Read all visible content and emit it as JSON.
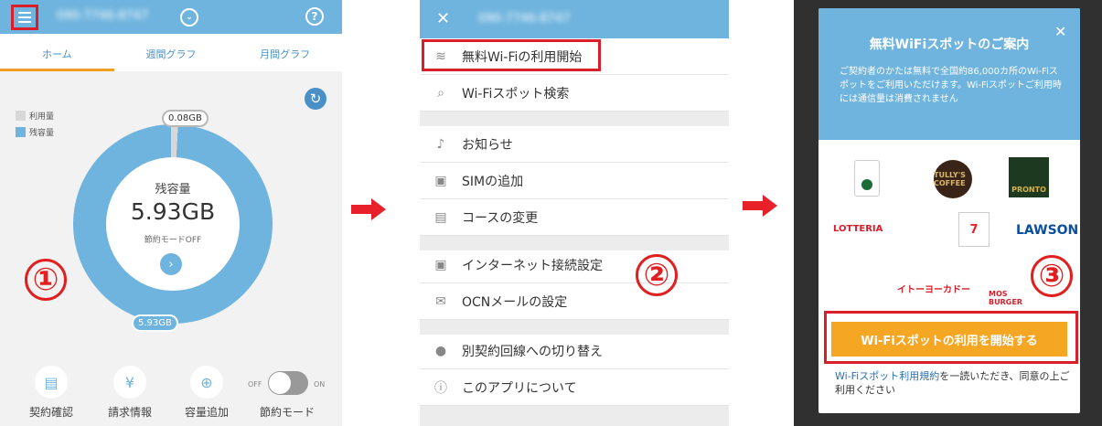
{
  "screen1": {
    "tabs": [
      "ホーム",
      "週間グラフ",
      "月間グラフ"
    ],
    "legend": {
      "used": "利用量",
      "remaining": "残容量"
    },
    "used_pill": "0.08GB",
    "center_label": "残容量",
    "center_value": "5.93GB",
    "saving_mode": "節約モードOFF",
    "bottom_pill": "5.93GB",
    "bottom_items": [
      "契約確認",
      "請求情報",
      "容量追加",
      "節約モード"
    ],
    "toggle_off": "OFF",
    "toggle_on": "ON",
    "step": "①",
    "usage": {
      "used_gb": 0.08,
      "remaining_gb": 5.93
    },
    "colors": {
      "header": "#6fb4de",
      "accent": "#f0a020",
      "highlight": "#d9202a"
    }
  },
  "screen2": {
    "menu": [
      {
        "icon": "wifi-icon",
        "label": "無料Wi-Fiの利用開始"
      },
      {
        "icon": "search-icon",
        "label": "Wi-Fiスポット検索"
      },
      {
        "icon": "bell-icon",
        "label": "お知らせ"
      },
      {
        "icon": "sim-add-icon",
        "label": "SIMの追加"
      },
      {
        "icon": "clipboard-icon",
        "label": "コースの変更"
      },
      {
        "icon": "network-settings-icon",
        "label": "インターネット接続設定"
      },
      {
        "icon": "mail-icon",
        "label": "OCNメールの設定"
      },
      {
        "icon": "person-icon",
        "label": "別契約回線への切り替え"
      },
      {
        "icon": "info-icon",
        "label": "このアプリについて"
      }
    ],
    "step": "②"
  },
  "screen3": {
    "title": "無料WiFiスポットのご案内",
    "description": "ご契約者のかたは無料で全国約86,000カ所のWi-Fiスポットをご利用いただけます。Wi-Fiスポットご利用時には通信量は消費されません",
    "logos": [
      "TULLY'S COFFEE",
      "PRONTO",
      "LOTTERIA",
      "7 ELEVEN",
      "LAWSON",
      "イトーヨーカドー",
      "MOS BURGER"
    ],
    "button": "Wi-Fiスポットの利用を開始する",
    "terms_link": "Wi-Fiスポット利用規約",
    "terms_text": "を一読いただき、同意の上ご利用ください",
    "step": "③"
  }
}
